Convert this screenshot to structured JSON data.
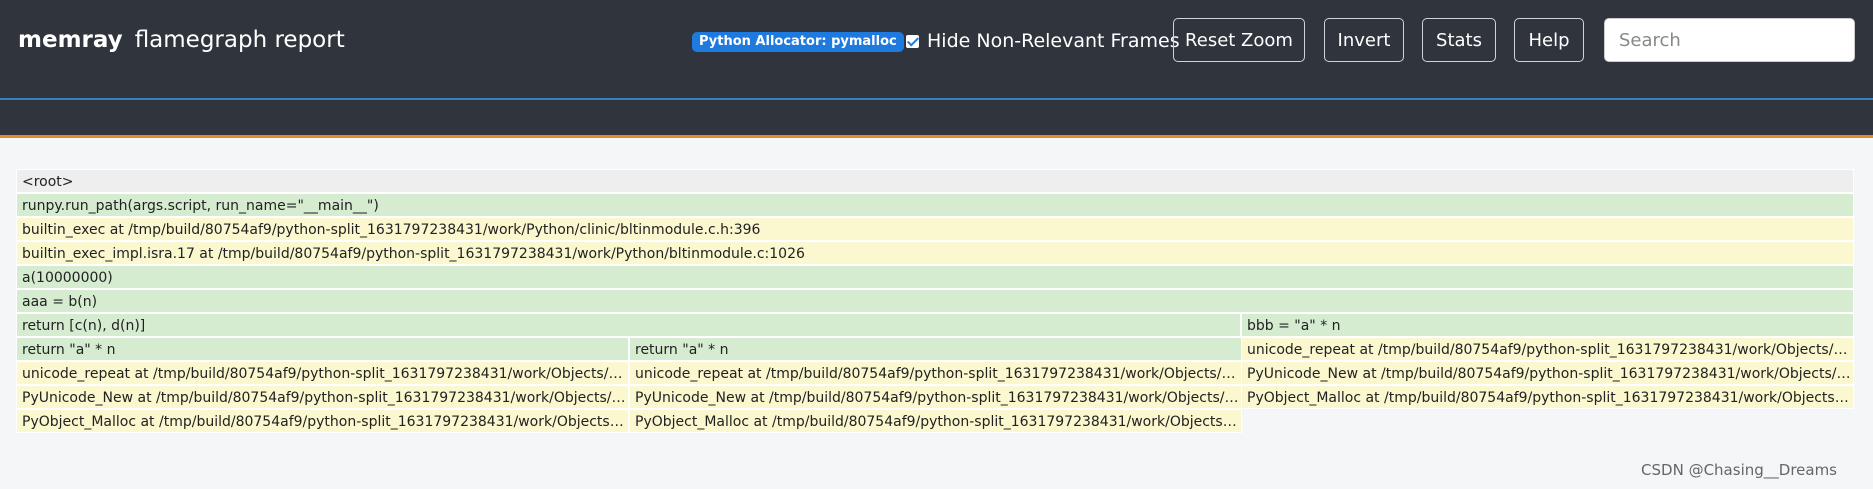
{
  "navbar": {
    "brand_bold": "memray",
    "brand_sub": "flamegraph report",
    "allocator_badge": "Python Allocator: pymalloc",
    "hide_frames_label": "Hide Non-Relevant Frames",
    "hide_frames_checked": true,
    "buttons": {
      "reset_zoom": "Reset Zoom",
      "invert": "Invert",
      "stats": "Stats",
      "help": "Help"
    },
    "search_placeholder": "Search"
  },
  "colors": {
    "navbar": "#2f343d",
    "badge": "#1f7ae0",
    "frame_green": "#d5ecd1",
    "frame_yellow": "#fbf8cf",
    "accent_orange": "#e08a2c"
  },
  "flamegraph": [
    [
      {
        "label": "<root>",
        "start": 0,
        "width": 1,
        "color": "r"
      }
    ],
    [
      {
        "label": "runpy.run_path(args.script, run_name=\"__main__\")",
        "start": 0,
        "width": 1,
        "color": "g"
      }
    ],
    [
      {
        "label": "builtin_exec at /tmp/build/80754af9/python-split_1631797238431/work/Python/clinic/bltinmodule.c.h:396",
        "start": 0,
        "width": 1,
        "color": "y"
      }
    ],
    [
      {
        "label": "builtin_exec_impl.isra.17 at /tmp/build/80754af9/python-split_1631797238431/work/Python/bltinmodule.c:1026",
        "start": 0,
        "width": 1,
        "color": "y"
      }
    ],
    [
      {
        "label": "a(10000000)",
        "start": 0,
        "width": 1,
        "color": "g"
      }
    ],
    [
      {
        "label": "aaa = b(n)",
        "start": 0,
        "width": 1,
        "color": "g"
      }
    ],
    [
      {
        "label": "return [c(n), d(n)]",
        "start": 0,
        "width": 0.6667,
        "color": "g"
      },
      {
        "label": "bbb = \"a\" * n",
        "start": 0.6667,
        "width": 0.3333,
        "color": "g"
      }
    ],
    [
      {
        "label": "return \"a\" * n",
        "start": 0,
        "width": 0.3333,
        "color": "g"
      },
      {
        "label": "return \"a\" * n",
        "start": 0.3333,
        "width": 0.3333,
        "color": "g"
      },
      {
        "label": "unicode_repeat at /tmp/build/80754af9/python-split_1631797238431/work/Objects/unicodeobject.c",
        "start": 0.6667,
        "width": 0.3333,
        "color": "y"
      }
    ],
    [
      {
        "label": "unicode_repeat at /tmp/build/80754af9/python-split_1631797238431/work/Objects/unicodeobject.c",
        "start": 0,
        "width": 0.3333,
        "color": "y"
      },
      {
        "label": "unicode_repeat at /tmp/build/80754af9/python-split_1631797238431/work/Objects/unicodeobject.c",
        "start": 0.3333,
        "width": 0.3333,
        "color": "y"
      },
      {
        "label": "PyUnicode_New at /tmp/build/80754af9/python-split_1631797238431/work/Objects/unicodeobject.c",
        "start": 0.6667,
        "width": 0.3333,
        "color": "y"
      }
    ],
    [
      {
        "label": "PyUnicode_New at /tmp/build/80754af9/python-split_1631797238431/work/Objects/unicodeobject.c",
        "start": 0,
        "width": 0.3333,
        "color": "y"
      },
      {
        "label": "PyUnicode_New at /tmp/build/80754af9/python-split_1631797238431/work/Objects/unicodeobject.c",
        "start": 0.3333,
        "width": 0.3333,
        "color": "y"
      },
      {
        "label": "PyObject_Malloc at /tmp/build/80754af9/python-split_1631797238431/work/Objects/obmalloc.c",
        "start": 0.6667,
        "width": 0.3333,
        "color": "y"
      }
    ],
    [
      {
        "label": "PyObject_Malloc at /tmp/build/80754af9/python-split_1631797238431/work/Objects/obmalloc.c",
        "start": 0,
        "width": 0.3333,
        "color": "y"
      },
      {
        "label": "PyObject_Malloc at /tmp/build/80754af9/python-split_1631797238431/work/Objects/obmalloc.c",
        "start": 0.3333,
        "width": 0.3333,
        "color": "y"
      }
    ]
  ],
  "watermark": "CSDN @Chasing__Dreams"
}
